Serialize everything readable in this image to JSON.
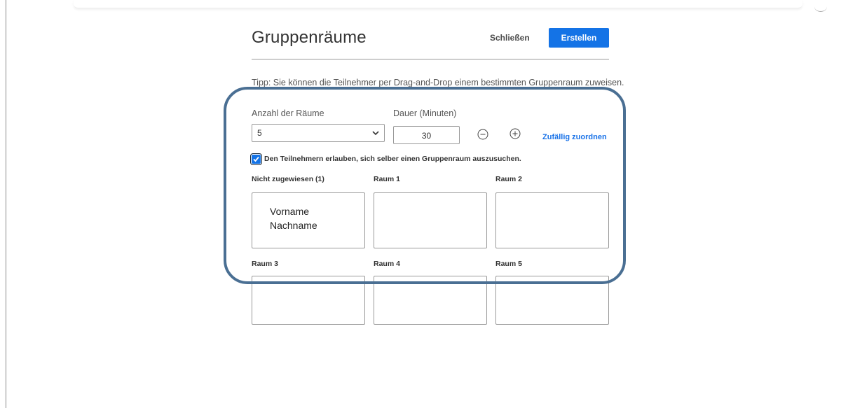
{
  "dialog": {
    "title": "Gruppenräume",
    "close_label": "Schließen",
    "create_label": "Erstellen",
    "tip": "Tipp: Sie können die Teilnehmer per Drag-and-Drop einem bestimmten Gruppenraum zuweisen."
  },
  "settings": {
    "rooms_label": "Anzahl der Räume",
    "rooms_value": "5",
    "duration_label": "Dauer (Minuten)",
    "duration_value": "30",
    "random_assign_label": "Zufällig zuordnen",
    "allow_self_select_label": "Den Teilnehmern erlauben, sich selber einen Gruppenraum auszusuchen.",
    "allow_self_select_checked": true
  },
  "rooms": [
    {
      "label": "Nicht zugewiesen (1)",
      "participants": [
        "Vorname",
        "Nachname"
      ]
    },
    {
      "label": "Raum 1",
      "participants": []
    },
    {
      "label": "Raum 2",
      "participants": []
    },
    {
      "label": "Raum 3",
      "participants": []
    },
    {
      "label": "Raum 4",
      "participants": []
    },
    {
      "label": "Raum 5",
      "participants": []
    }
  ],
  "icons": {
    "decrement": "minus-circle-icon",
    "increment": "plus-circle-icon",
    "dropdown": "chevron-down-icon",
    "check": "checkmark-icon"
  },
  "colors": {
    "accent": "#1473e6",
    "highlight_border": "#4a6f93"
  }
}
